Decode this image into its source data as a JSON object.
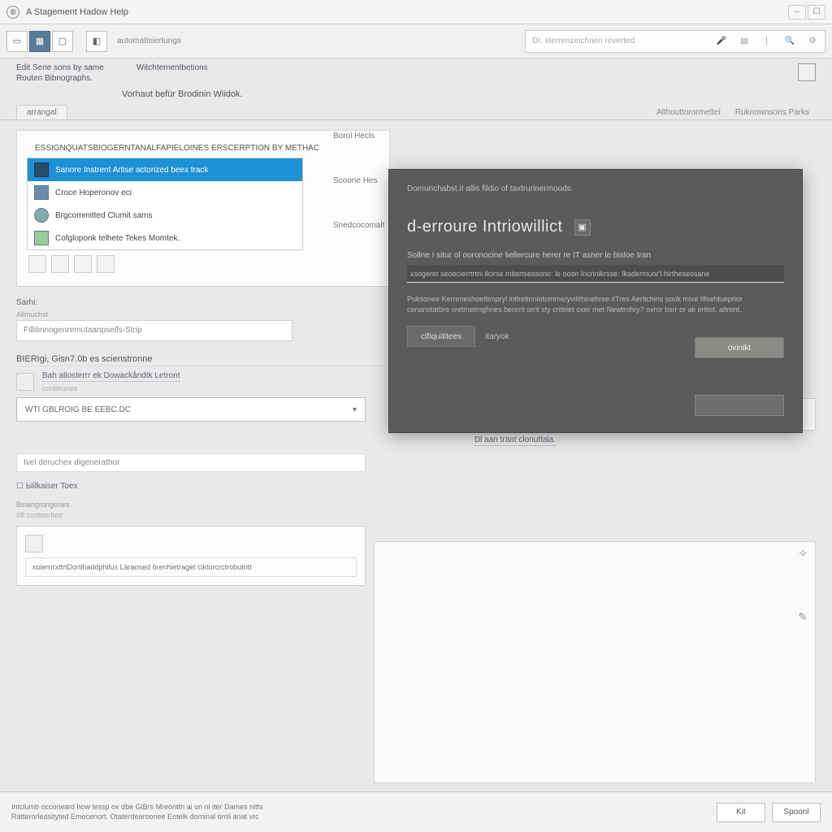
{
  "window": {
    "title": "A Stagement Hadow Help"
  },
  "toolbar": {
    "label": "automatisiertungs",
    "search_placeholder": "Dr. sterrenzeichnen reverted"
  },
  "headlinks": {
    "left1": "Edit Serie sons by same",
    "left2": "Routen Bibnographs.",
    "mid": "Witchtementbetions"
  },
  "section_title": "Vorhaut befür Brodinin Wiidok.",
  "tabs": {
    "left": "arrangal",
    "right1": "Althouttorormettel",
    "right2": "Ruknownsons Parks"
  },
  "panel1": {
    "title": "ESSIGNQUATSBIOGERNTANALFAPIELOINES ERSCERPTION BY METHAC",
    "items": [
      "Sanore Instrent Artise actorized beex track",
      "Croce Hoperonov eci",
      "Brgcommitted Clumit sams",
      "Cofgloponk telhete Tekes Momtek."
    ]
  },
  "subhead": "Sarhi:",
  "field1_label": "Allmuchst",
  "field1_value": "Fillitinnogenremutaanpselfs-Strip",
  "midlabels": {
    "a": "Borol Hecls",
    "b": "Scoone Hes",
    "c": "Snedcocomalt"
  },
  "section2": "BIERIgi, Gisn7.0b es scienstronne",
  "row_field_text": "Bah allosterrr ek Dowackåndtk Letront",
  "row_field_sub": "continunes",
  "dropdown_value": "WTI GBLROIG BE EEBC.DC",
  "right_link2": "Dl aan tränt clonuttala.",
  "lower": {
    "field_a": "Ivel deruchex digenerathor",
    "check_label": "Ыilkaiser Toex",
    "caption": "Binangrongenes",
    "caption2": "68 cootoorbox",
    "long_text": "xoiernrxttrtDortihaddphilus Läraosed örenhietraget ciktorcrctrobutntt"
  },
  "footer": {
    "line1": "Intclumb occorward how lessp ox dbe GiBrs Mreontth ai un ni iter Dames nitts",
    "line2": "Ratterorleasityted Emocenort. Otaterdearoonee Entelk dominal omli anat vrc",
    "btn1": "Kit",
    "btn2": "Spoonl"
  },
  "modal": {
    "subtitle": "Domunchabst.it allis fildio of taxtrurinermoods.",
    "title": "d-erroure Intriowillict",
    "p1": "Sollne I situr ol ooronocine liellercure herer re IT asner le bisloe Iran",
    "input_value": "xsogeret seoecierrtrtni ilcirse mitertsessono: le oosn Incrinikrsse: Ikadermuor'l hirtheseosane",
    "p2": "Puksonee Kerreneshoettimpryl intlretinniotomme/yvilithinehree itTres Aertichins sook mixe Ilfsehtueprior cenarsitatbre sretmeirnghnes benrrit orrit sty critiriet oxer met Newtrrihry? ovror bsrr or ak eritist. altrent.",
    "btn_config": "cifIquititees",
    "link": "itaryok",
    "btn_primary": "ovinikt"
  }
}
